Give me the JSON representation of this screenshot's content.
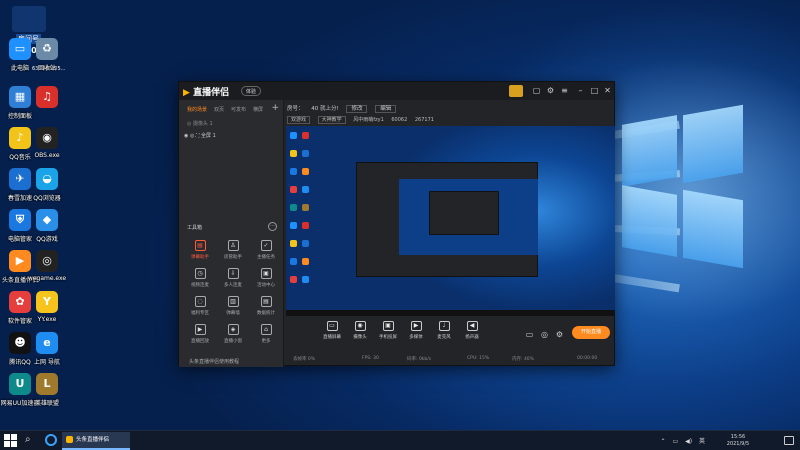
{
  "desktop": {
    "icons": [
      {
        "label": "此电脑",
        "name": "this-pc-icon",
        "color": "#1e90ff",
        "glyph": "▭"
      },
      {
        "label": "回收站",
        "name": "recycle-bin-icon",
        "color": "#6b8aa8",
        "glyph": "♻"
      },
      {
        "label": "控制面板",
        "name": "control-panel-icon",
        "color": "#2f7fd4",
        "glyph": "▦"
      },
      {
        "label": "",
        "name": "netease-music-icon",
        "color": "#d9302b",
        "glyph": "♫"
      },
      {
        "label": "QQ音乐",
        "name": "qq-music-icon",
        "color": "#f2c318",
        "glyph": "♪"
      },
      {
        "label": "OBS.exe",
        "name": "obs-icon",
        "color": "#222222",
        "glyph": "◉"
      },
      {
        "label": "春雪加速",
        "name": "accelerator-icon",
        "color": "#1a6fd1",
        "glyph": "✈"
      },
      {
        "label": "QQ浏览器",
        "name": "qq-browser-icon",
        "color": "#1aa3e8",
        "glyph": "◒"
      },
      {
        "label": "电脑管家",
        "name": "pc-manager-icon",
        "color": "#1b78e0",
        "glyph": "⛨"
      },
      {
        "label": "QQ游戏",
        "name": "qq-game-icon",
        "color": "#2a8fe8",
        "glyph": "◆"
      },
      {
        "label": "头条直播伴侣",
        "name": "douyin-live-icon",
        "color": "#ff8a1f",
        "glyph": "▶"
      },
      {
        "label": "wegame.exe",
        "name": "wegame-icon",
        "color": "#222222",
        "glyph": "◎"
      },
      {
        "label": "软件管家",
        "name": "software-manager-icon",
        "color": "#e63d3d",
        "glyph": "✿"
      },
      {
        "label": "YY.exe",
        "name": "yy-icon",
        "color": "#f7c41d",
        "glyph": "Y"
      },
      {
        "label": "腾讯QQ",
        "name": "tencent-qq-icon",
        "color": "#111111",
        "glyph": "☻"
      },
      {
        "label": "上网 导航",
        "name": "ie-navigation-icon",
        "color": "#1e8cf0",
        "glyph": "e"
      },
      {
        "label": "网易UU加速器",
        "name": "uu-accelerator-icon",
        "color": "#0f8a8a",
        "glyph": "U"
      },
      {
        "label": "英雄联盟",
        "name": "league-of-legends-icon",
        "color": "#a07a2c",
        "glyph": "L"
      }
    ],
    "top_overlay": {
      "line1": "房间号",
      "line2": "60062",
      "line3": "636647305..."
    }
  },
  "app": {
    "title": "直播伴侣",
    "edition": "体验",
    "scene_tabs": [
      "我的场景",
      "双页",
      "可发布",
      "横屏"
    ],
    "source_tools": "◎ 摄像头 1",
    "source_row": "◉  ◎  ⛶ 全屏 1",
    "toolbox_title": "工具箱",
    "tools": [
      {
        "label": "弹幕助手",
        "glyph": "▤",
        "red": true
      },
      {
        "label": "房管助手",
        "glyph": "♙",
        "red": false
      },
      {
        "label": "主播任务",
        "glyph": "✓",
        "red": false
      },
      {
        "label": "视频连麦",
        "glyph": "◷",
        "red": false
      },
      {
        "label": "多人连麦",
        "glyph": "⇩",
        "red": false
      },
      {
        "label": "活动中心",
        "glyph": "▣",
        "red": false
      },
      {
        "label": "福利专区",
        "glyph": "◌",
        "red": false
      },
      {
        "label": "弹幕墙",
        "glyph": "▥",
        "red": false
      },
      {
        "label": "数据统计",
        "glyph": "▤",
        "red": false
      },
      {
        "label": "直播回放",
        "glyph": "▶",
        "red": false
      },
      {
        "label": "直播小窗",
        "glyph": "◈",
        "red": false
      },
      {
        "label": "更多",
        "glyph": "⌂",
        "red": false
      }
    ],
    "broadcast_note": "头条直播伴侣使用教程",
    "room": {
      "label": "房号：",
      "title": "40 就上分!",
      "btn1": "修改",
      "btn2": "编辑"
    },
    "room2": {
      "tag1": "双游戏",
      "tag2": "大神教学",
      "stat1": "风中雨萌fzy1",
      "stat2": "60062",
      "stat3": "267171"
    },
    "controls": [
      {
        "label": "直播屏幕",
        "glyph": "▭"
      },
      {
        "label": "摄像头",
        "glyph": "◉"
      },
      {
        "label": "手机投屏",
        "glyph": "▣"
      },
      {
        "label": "多媒体",
        "glyph": "▶"
      },
      {
        "label": "麦克风",
        "glyph": "♩"
      },
      {
        "label": "扬声器",
        "glyph": "◀"
      }
    ],
    "start_label": "开始直播",
    "status": {
      "left": "丢帧率 0%",
      "fps": "FPS: 30",
      "bitrate": "码率: 0kb/s",
      "cpu": "CPU: 15%",
      "mem": "内存: 40%",
      "time": "00:00:00"
    }
  },
  "taskbar": {
    "app_label": "头条直播伴侣",
    "tray_lang": "英",
    "clock_time": "15:56",
    "clock_date": "2021/9/5"
  }
}
